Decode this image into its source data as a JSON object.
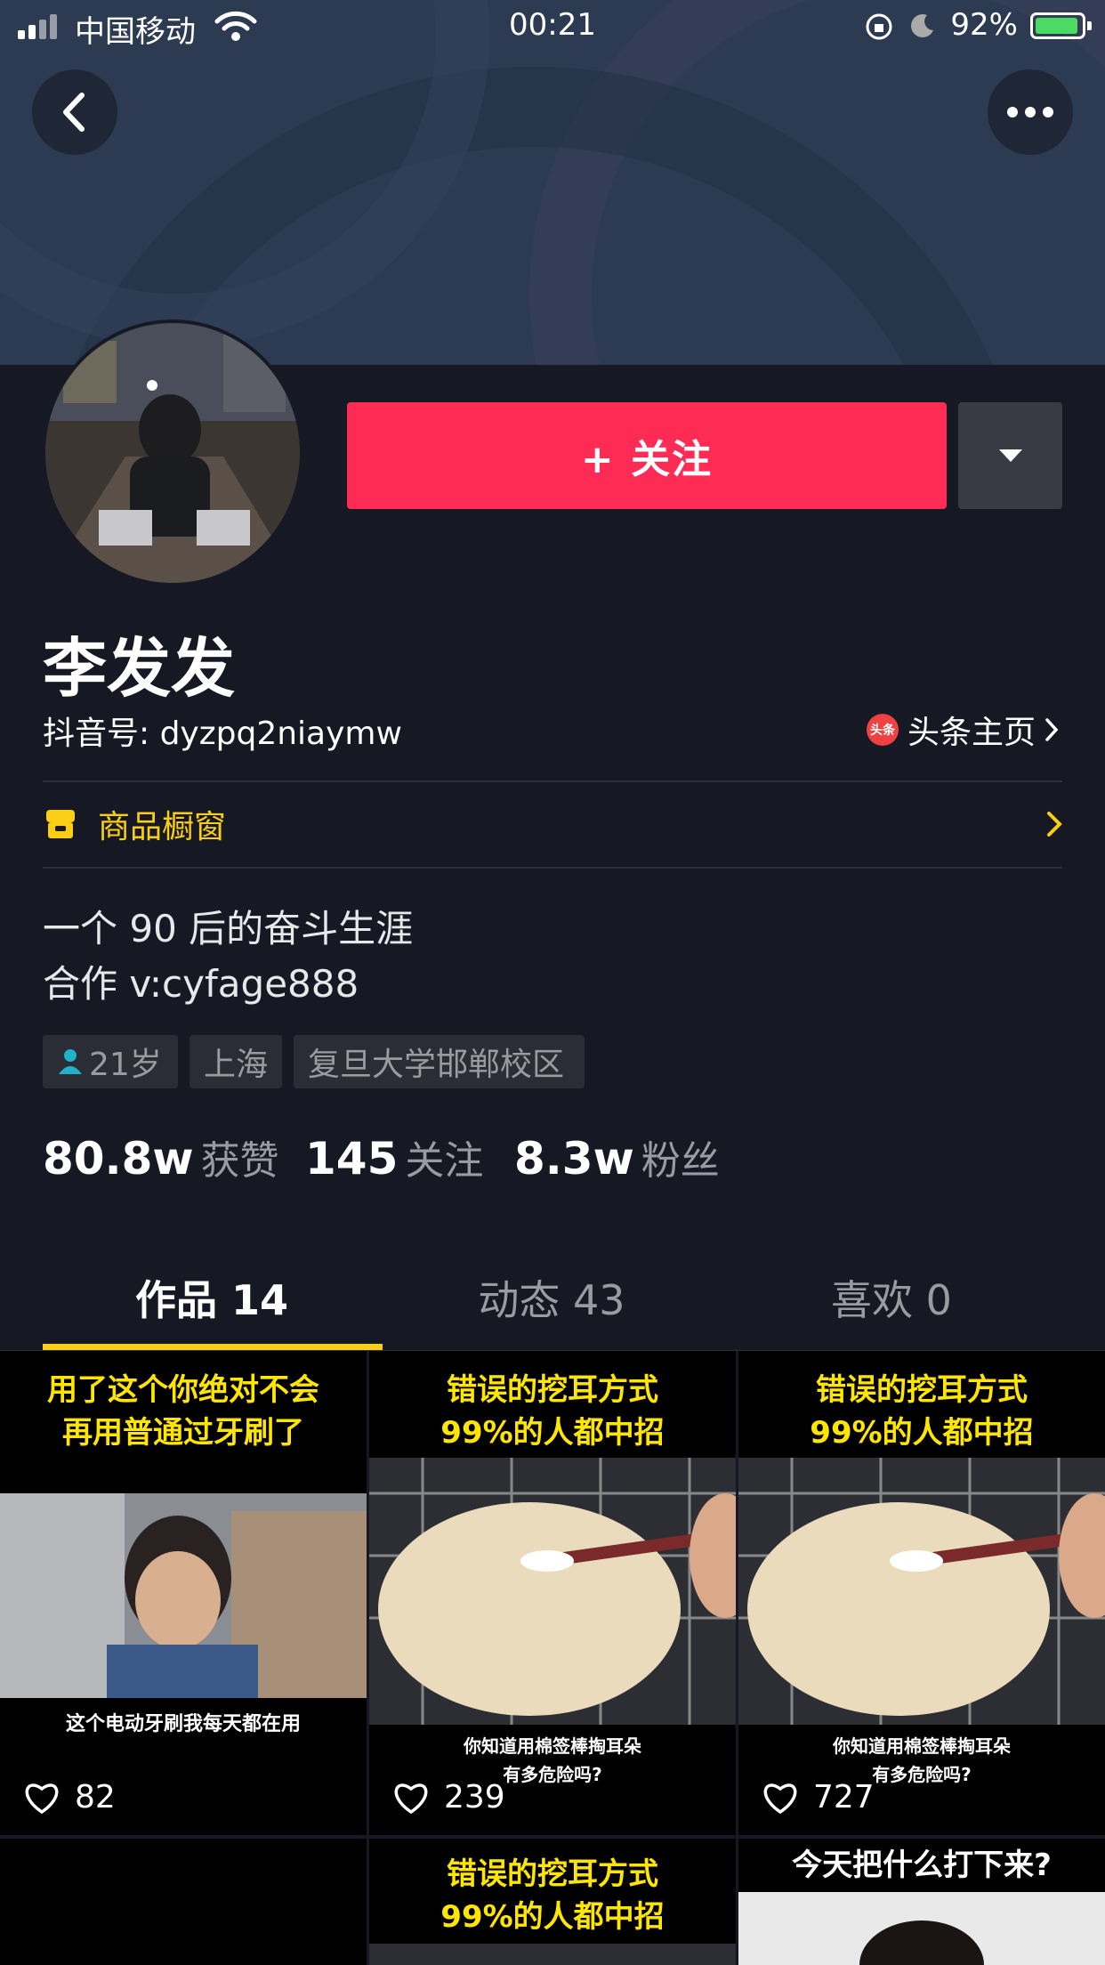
{
  "status_bar": {
    "carrier": "中国移动",
    "time": "00:21",
    "battery": "92%"
  },
  "profile": {
    "name": "李发发",
    "douyin_id": "抖音号: dyzpq2niaymw",
    "toutiao_link": "头条主页",
    "toutiao_logo_text": "头条",
    "follow_label": "+ 关注",
    "shop_label": "商品橱窗",
    "bio": [
      "一个 90 后的奋斗生涯",
      "合作 v:cyfage888"
    ],
    "tags": [
      "21岁",
      "上海",
      "复旦大学邯郸校区"
    ],
    "stats": [
      {
        "value": "80.8w",
        "label": "获赞"
      },
      {
        "value": "145",
        "label": "关注"
      },
      {
        "value": "8.3w",
        "label": "粉丝"
      }
    ]
  },
  "tabs": [
    {
      "label": "作品 14",
      "active": true
    },
    {
      "label": "动态 43",
      "active": false
    },
    {
      "label": "喜欢 0",
      "active": false
    }
  ],
  "videos": [
    {
      "top_caption": [
        "用了这个你绝对不会",
        "再用普通过牙刷了"
      ],
      "bottom_caption": [
        "这个电动牙刷我每天都在用"
      ],
      "likes": "82"
    },
    {
      "top_caption": [
        "错误的挖耳方式",
        "99%的人都中招"
      ],
      "bottom_caption": [
        "你知道用棉签棒掏耳朵",
        "有多危险吗?"
      ],
      "likes": "239"
    },
    {
      "top_caption": [
        "错误的挖耳方式",
        "99%的人都中招"
      ],
      "bottom_caption": [
        "你知道用棉签棒掏耳朵",
        "有多危险吗?"
      ],
      "likes": "727"
    },
    {
      "top_caption": [],
      "bottom_caption": [],
      "likes": ""
    },
    {
      "top_caption": [
        "错误的挖耳方式",
        "99%的人都中招"
      ],
      "bottom_caption": [],
      "likes": ""
    },
    {
      "top_caption": [
        "今天把什么打下来?"
      ],
      "bottom_caption": [],
      "likes": ""
    }
  ],
  "colors": {
    "accent": "#fe2c55",
    "highlight": "#face15",
    "background": "#161823"
  },
  "icons": [
    "back-icon",
    "more-icon",
    "dropdown-icon",
    "shop-icon",
    "chevron-right-icon",
    "user-icon",
    "heart-icon",
    "wifi-icon",
    "battery-icon"
  ]
}
